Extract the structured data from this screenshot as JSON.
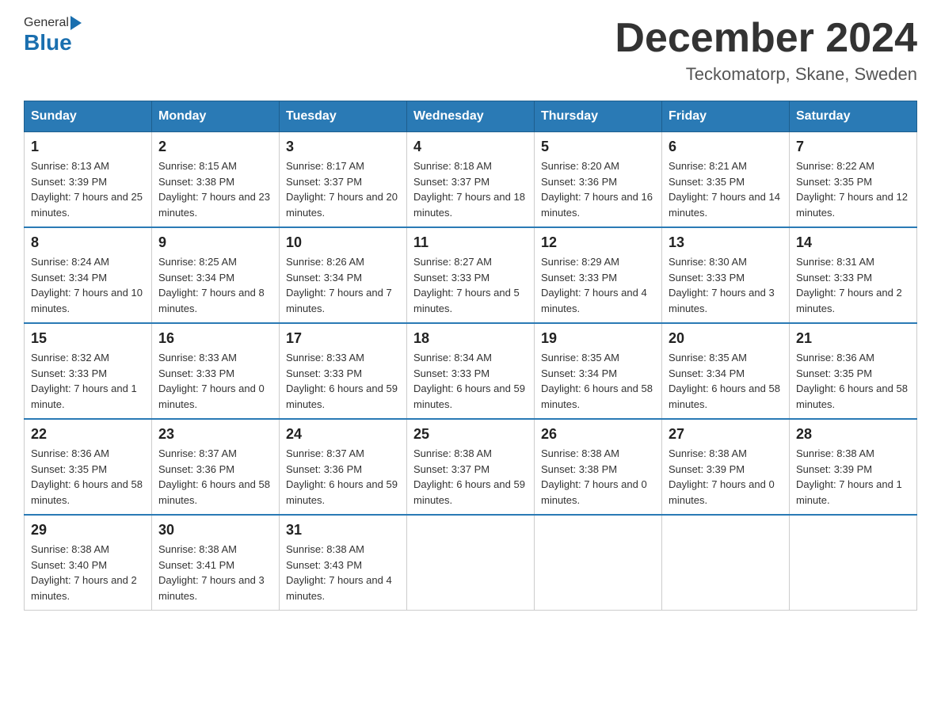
{
  "header": {
    "logo_general": "General",
    "logo_blue": "Blue",
    "month_title": "December 2024",
    "location": "Teckomatorp, Skane, Sweden"
  },
  "weekdays": [
    "Sunday",
    "Monday",
    "Tuesday",
    "Wednesday",
    "Thursday",
    "Friday",
    "Saturday"
  ],
  "weeks": [
    [
      {
        "day": "1",
        "sunrise": "8:13 AM",
        "sunset": "3:39 PM",
        "daylight": "7 hours and 25 minutes."
      },
      {
        "day": "2",
        "sunrise": "8:15 AM",
        "sunset": "3:38 PM",
        "daylight": "7 hours and 23 minutes."
      },
      {
        "day": "3",
        "sunrise": "8:17 AM",
        "sunset": "3:37 PM",
        "daylight": "7 hours and 20 minutes."
      },
      {
        "day": "4",
        "sunrise": "8:18 AM",
        "sunset": "3:37 PM",
        "daylight": "7 hours and 18 minutes."
      },
      {
        "day": "5",
        "sunrise": "8:20 AM",
        "sunset": "3:36 PM",
        "daylight": "7 hours and 16 minutes."
      },
      {
        "day": "6",
        "sunrise": "8:21 AM",
        "sunset": "3:35 PM",
        "daylight": "7 hours and 14 minutes."
      },
      {
        "day": "7",
        "sunrise": "8:22 AM",
        "sunset": "3:35 PM",
        "daylight": "7 hours and 12 minutes."
      }
    ],
    [
      {
        "day": "8",
        "sunrise": "8:24 AM",
        "sunset": "3:34 PM",
        "daylight": "7 hours and 10 minutes."
      },
      {
        "day": "9",
        "sunrise": "8:25 AM",
        "sunset": "3:34 PM",
        "daylight": "7 hours and 8 minutes."
      },
      {
        "day": "10",
        "sunrise": "8:26 AM",
        "sunset": "3:34 PM",
        "daylight": "7 hours and 7 minutes."
      },
      {
        "day": "11",
        "sunrise": "8:27 AM",
        "sunset": "3:33 PM",
        "daylight": "7 hours and 5 minutes."
      },
      {
        "day": "12",
        "sunrise": "8:29 AM",
        "sunset": "3:33 PM",
        "daylight": "7 hours and 4 minutes."
      },
      {
        "day": "13",
        "sunrise": "8:30 AM",
        "sunset": "3:33 PM",
        "daylight": "7 hours and 3 minutes."
      },
      {
        "day": "14",
        "sunrise": "8:31 AM",
        "sunset": "3:33 PM",
        "daylight": "7 hours and 2 minutes."
      }
    ],
    [
      {
        "day": "15",
        "sunrise": "8:32 AM",
        "sunset": "3:33 PM",
        "daylight": "7 hours and 1 minute."
      },
      {
        "day": "16",
        "sunrise": "8:33 AM",
        "sunset": "3:33 PM",
        "daylight": "7 hours and 0 minutes."
      },
      {
        "day": "17",
        "sunrise": "8:33 AM",
        "sunset": "3:33 PM",
        "daylight": "6 hours and 59 minutes."
      },
      {
        "day": "18",
        "sunrise": "8:34 AM",
        "sunset": "3:33 PM",
        "daylight": "6 hours and 59 minutes."
      },
      {
        "day": "19",
        "sunrise": "8:35 AM",
        "sunset": "3:34 PM",
        "daylight": "6 hours and 58 minutes."
      },
      {
        "day": "20",
        "sunrise": "8:35 AM",
        "sunset": "3:34 PM",
        "daylight": "6 hours and 58 minutes."
      },
      {
        "day": "21",
        "sunrise": "8:36 AM",
        "sunset": "3:35 PM",
        "daylight": "6 hours and 58 minutes."
      }
    ],
    [
      {
        "day": "22",
        "sunrise": "8:36 AM",
        "sunset": "3:35 PM",
        "daylight": "6 hours and 58 minutes."
      },
      {
        "day": "23",
        "sunrise": "8:37 AM",
        "sunset": "3:36 PM",
        "daylight": "6 hours and 58 minutes."
      },
      {
        "day": "24",
        "sunrise": "8:37 AM",
        "sunset": "3:36 PM",
        "daylight": "6 hours and 59 minutes."
      },
      {
        "day": "25",
        "sunrise": "8:38 AM",
        "sunset": "3:37 PM",
        "daylight": "6 hours and 59 minutes."
      },
      {
        "day": "26",
        "sunrise": "8:38 AM",
        "sunset": "3:38 PM",
        "daylight": "7 hours and 0 minutes."
      },
      {
        "day": "27",
        "sunrise": "8:38 AM",
        "sunset": "3:39 PM",
        "daylight": "7 hours and 0 minutes."
      },
      {
        "day": "28",
        "sunrise": "8:38 AM",
        "sunset": "3:39 PM",
        "daylight": "7 hours and 1 minute."
      }
    ],
    [
      {
        "day": "29",
        "sunrise": "8:38 AM",
        "sunset": "3:40 PM",
        "daylight": "7 hours and 2 minutes."
      },
      {
        "day": "30",
        "sunrise": "8:38 AM",
        "sunset": "3:41 PM",
        "daylight": "7 hours and 3 minutes."
      },
      {
        "day": "31",
        "sunrise": "8:38 AM",
        "sunset": "3:43 PM",
        "daylight": "7 hours and 4 minutes."
      },
      null,
      null,
      null,
      null
    ]
  ]
}
